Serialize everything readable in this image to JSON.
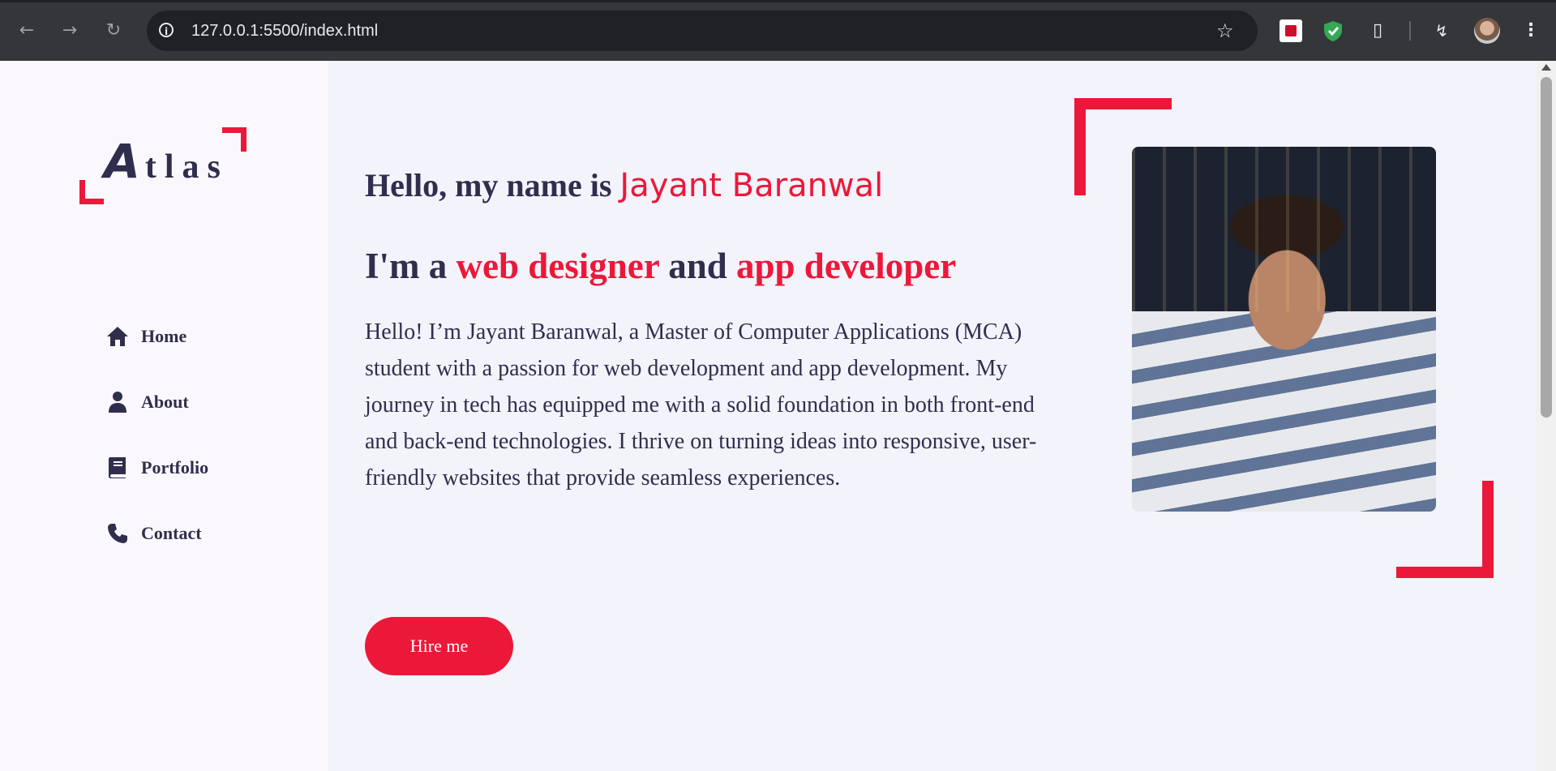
{
  "browser": {
    "url": "127.0.0.1:5500/index.html",
    "back_icon": "arrow-left-icon",
    "forward_icon": "arrow-right-icon",
    "reload_icon": "reload-icon",
    "bookmark_icon": "star-icon",
    "extensions": [
      "mcafee-icon",
      "shield-icon",
      "puzzle-icon",
      "bolt-icon",
      "avatar",
      "menu-icon"
    ]
  },
  "sidebar": {
    "logo": {
      "letter": "A",
      "rest": "tlas"
    },
    "items": [
      {
        "label": "Home",
        "icon": "home-icon"
      },
      {
        "label": "About",
        "icon": "user-icon"
      },
      {
        "label": "Portfolio",
        "icon": "book-icon"
      },
      {
        "label": "Contact",
        "icon": "phone-icon"
      }
    ]
  },
  "hero": {
    "greeting": "Hello, my name is ",
    "name": "Jayant Baranwal",
    "role_prefix": "I'm a ",
    "role1": "web designer",
    "role_mid": " and ",
    "role2": "app developer",
    "bio": "Hello! I’m Jayant Baranwal, a Master of Computer Applications (MCA) student with a passion for web development and app development. My journey in tech has equipped me with a solid foundation in both front-end and back-end technologies. I thrive on turning ideas into responsive, user-friendly websites that provide seamless experiences.",
    "hire_label": "Hire me"
  },
  "colors": {
    "accent": "#ec1839",
    "text": "#302e4d",
    "main_bg": "#f2f3fb",
    "sidebar_bg": "#fbf8fd"
  }
}
